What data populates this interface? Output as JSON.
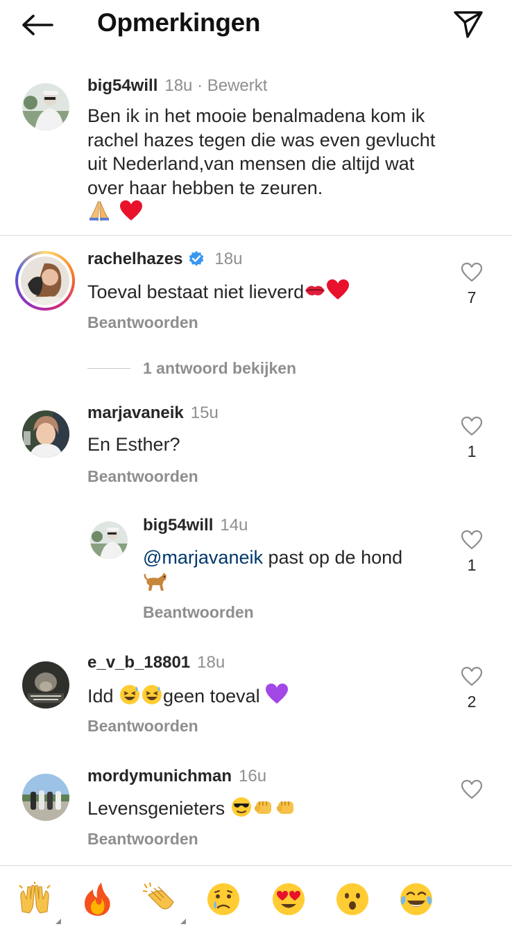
{
  "header": {
    "title": "Opmerkingen",
    "back_icon": "arrow-left-icon",
    "share_icon": "paper-plane-icon"
  },
  "caption": {
    "username": "big54will",
    "time": "18u",
    "edited": "· Bewerkt",
    "text": "Ben ik in het mooie benalmadena kom ik rachel hazes tegen die was even gevlucht uit Nederland,van mensen die altijd wat over haar hebben te zeuren.",
    "emojis": [
      "folded-hands-icon",
      "red-heart-icon"
    ]
  },
  "comments": [
    {
      "username": "rachelhazes",
      "verified": true,
      "time": "18u",
      "text": "Toeval bestaat niet lieverd",
      "emojis": [
        "kiss-mark-icon",
        "red-heart-icon"
      ],
      "likes": "7",
      "reply_label": "Beantwoorden",
      "view_replies": "1 antwoord bekijken"
    },
    {
      "username": "marjavaneik",
      "time": "15u",
      "text": "En Esther?",
      "likes": "1",
      "reply_label": "Beantwoorden"
    },
    {
      "username": "big54will",
      "time": "14u",
      "mention": "@marjavaneik",
      "text": " past op de hond",
      "emojis": [
        "dog-icon"
      ],
      "likes": "1",
      "reply_label": "Beantwoorden",
      "is_reply": true
    },
    {
      "username": "e_v_b_18801",
      "time": "18u",
      "text_before": "Idd ",
      "text_after": "geen toeval ",
      "emojis": [
        "laughing-sweat-icon",
        "laughing-sweat-icon",
        "purple-heart-icon"
      ],
      "likes": "2",
      "reply_label": "Beantwoorden"
    },
    {
      "username": "mordymunichman",
      "time": "16u",
      "text": "Levensgenieters ",
      "emojis": [
        "sunglasses-face-icon",
        "fist-bump-icon",
        "fist-bump-icon"
      ],
      "likes": "",
      "reply_label": "Beantwoorden"
    }
  ],
  "reactions": [
    "raising-hands-icon",
    "fire-icon",
    "clapping-hands-icon",
    "crying-face-icon",
    "heart-eyes-icon",
    "surprised-face-icon",
    "tears-of-joy-icon"
  ],
  "colors": {
    "text": "#262626",
    "muted": "#8e8e8e",
    "mention": "#00376b",
    "verified": "#3897f0",
    "divider": "#dbdbdb"
  }
}
